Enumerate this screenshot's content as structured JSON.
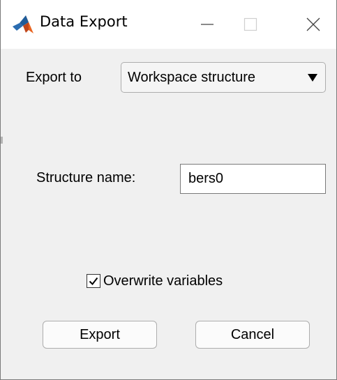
{
  "window": {
    "title": "Data Export",
    "controls": {
      "minimize_icon": "minimize-icon",
      "maximize_icon": "maximize-icon",
      "close_icon": "close-icon"
    },
    "app_icon": "matlab-logo-icon"
  },
  "export_to": {
    "label": "Export to",
    "selected": "Workspace structure"
  },
  "structure_name": {
    "label": "Structure name:",
    "value": "bers0"
  },
  "overwrite": {
    "label": "Overwrite variables",
    "checked": true
  },
  "buttons": {
    "export": "Export",
    "cancel": "Cancel"
  },
  "colors": {
    "window_bg": "#f0f0f0",
    "titlebar_bg": "#ffffff",
    "logo_orange": "#d9591a",
    "logo_blue": "#1f5c99"
  }
}
